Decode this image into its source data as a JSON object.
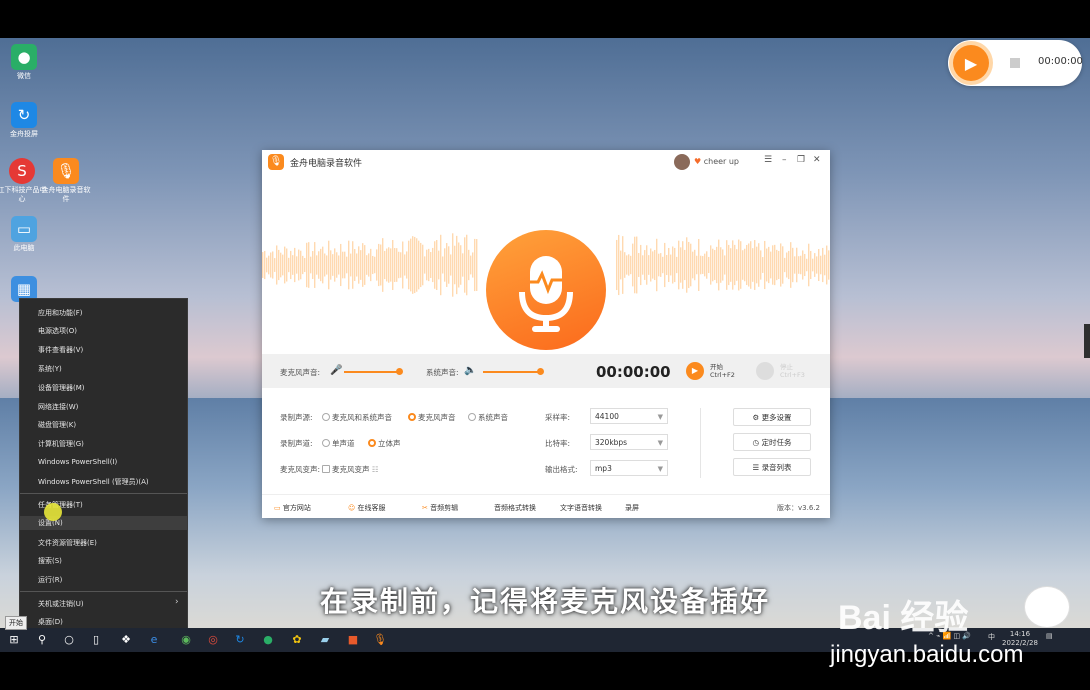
{
  "desktop": {
    "icons": [
      {
        "label": "微信",
        "icon": "wechat-icon",
        "color": "#2aae67"
      },
      {
        "label": "金舟投屏",
        "icon": "screencast-icon",
        "color": "#1e88e5"
      },
      {
        "label": "江下科技产品中心",
        "icon": "product-center-icon",
        "color": "#e53935"
      },
      {
        "label": "金舟电脑录音软件",
        "icon": "recorder-icon",
        "color": "#fb8a1e"
      },
      {
        "label": "此电脑",
        "icon": "computer-icon",
        "color": "#4fa3e0"
      }
    ]
  },
  "mini_recorder": {
    "time": "00:00:00"
  },
  "app": {
    "title": "金舟电脑录音软件",
    "user": "cheer up",
    "controls": {
      "menu": "☰",
      "minimize": "–",
      "maximize": "❐",
      "close": "✕"
    },
    "volume": {
      "mic_label": "麦克风声音:",
      "mic_level": 0.95,
      "system_label": "系统声音:",
      "system_level": 0.95,
      "timer": "00:00:00",
      "start_label": "开始",
      "start_hotkey": "Ctrl+F2",
      "stop_label": "停止",
      "stop_hotkey": "Ctrl+F3"
    },
    "settings": {
      "source_label": "录制声源:",
      "source_options": [
        "麦克风和系统声音",
        "麦克风声音",
        "系统声音"
      ],
      "source_selected": 1,
      "channel_label": "录制声道:",
      "channel_options": [
        "单声道",
        "立体声"
      ],
      "channel_selected": 1,
      "voice_label": "麦克风变声:",
      "voice_option": "麦克风变声",
      "sample_label": "采样率:",
      "sample_value": "44100",
      "bitrate_label": "比特率:",
      "bitrate_value": "320kbps",
      "format_label": "输出格式:",
      "format_value": "mp3",
      "more_settings": "更多设置",
      "timed_task": "定时任务",
      "record_list": "录音列表"
    },
    "footer": {
      "links": [
        "官方网站",
        "在线客服",
        "音频剪辑",
        "音频格式转换",
        "文字语音转换",
        "录屏"
      ],
      "version": "版本：v3.6.2"
    }
  },
  "start_menu": {
    "items": [
      "应用和功能(F)",
      "电源选项(O)",
      "事件查看器(V)",
      "系统(Y)",
      "设备管理器(M)",
      "网络连接(W)",
      "磁盘管理(K)",
      "计算机管理(G)",
      "Windows PowerShell(I)",
      "Windows PowerShell (管理员)(A)",
      "任务管理器(T)",
      "设置(N)",
      "文件资源管理器(E)",
      "搜索(S)",
      "运行(R)",
      "关机或注销(U)",
      "桌面(D)"
    ],
    "active_index": 11,
    "start_tooltip": "开始"
  },
  "taskbar": {
    "clock_time": "14:16",
    "clock_date": "2022/2/28",
    "ime": "中"
  },
  "overlay": {
    "subtitle": "在录制前，记得将麦克风设备插好",
    "watermark": "Bai  经验",
    "watermark_url": "jingyan.baidu.com"
  }
}
